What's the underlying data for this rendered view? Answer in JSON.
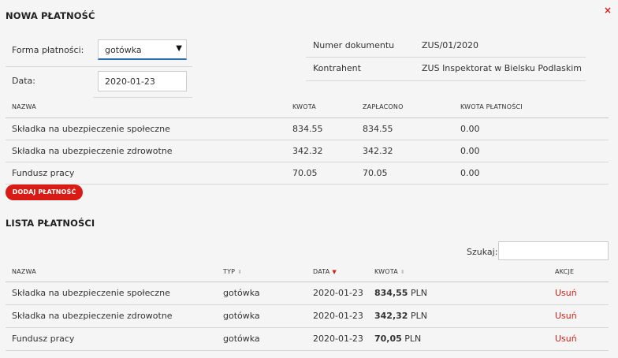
{
  "dialog": {
    "title": "NOWA PŁATNOŚĆ",
    "close": "×"
  },
  "form": {
    "forma_label": "Forma płatności:",
    "forma_value": "gotówka",
    "data_label": "Data:",
    "data_value": "2020-01-23",
    "numer_label": "Numer dokumentu",
    "numer_value": "ZUS/01/2020",
    "kontrahent_label": "Kontrahent",
    "kontrahent_value": "ZUS Inspektorat w Bielsku Podlaskim"
  },
  "items_table": {
    "headers": [
      "NAZWA",
      "KWOTA",
      "ZAPŁACONO",
      "KWOTA PŁATNOŚCI"
    ],
    "rows": [
      {
        "nazwa": "Składka na ubezpieczenie społeczne",
        "kwota": "834.55",
        "zaplacono": "834.55",
        "platnosci": "0.00"
      },
      {
        "nazwa": "Składka na ubezpieczenie zdrowotne",
        "kwota": "342.32",
        "zaplacono": "342.32",
        "platnosci": "0.00"
      },
      {
        "nazwa": "Fundusz pracy",
        "kwota": "70.05",
        "zaplacono": "70.05",
        "platnosci": "0.00"
      }
    ]
  },
  "add_button": "DODAJ PŁATNOŚĆ",
  "list": {
    "title": "LISTA PŁATNOŚCI",
    "search_label": "Szukaj:",
    "search_value": "",
    "headers": {
      "nazwa": "NAZWA",
      "typ": "TYP",
      "data": "DATA",
      "kwota": "KWOTA",
      "akcje": "AKCJE"
    },
    "sort_icons": {
      "inactive": "⬍",
      "active": "▼"
    },
    "rows": [
      {
        "nazwa": "Składka na ubezpieczenie społeczne",
        "typ": "gotówka",
        "data": "2020-01-23",
        "kwota": "834,55",
        "waluta": "PLN",
        "akcja": "Usuń"
      },
      {
        "nazwa": "Składka na ubezpieczenie zdrowotne",
        "typ": "gotówka",
        "data": "2020-01-23",
        "kwota": "342,32",
        "waluta": "PLN",
        "akcja": "Usuń"
      },
      {
        "nazwa": "Fundusz pracy",
        "typ": "gotówka",
        "data": "2020-01-23",
        "kwota": "70,05",
        "waluta": "PLN",
        "akcja": "Usuń"
      }
    ]
  },
  "colors": {
    "accent_red": "#d91b15",
    "select_underline": "#2a6fb3"
  }
}
